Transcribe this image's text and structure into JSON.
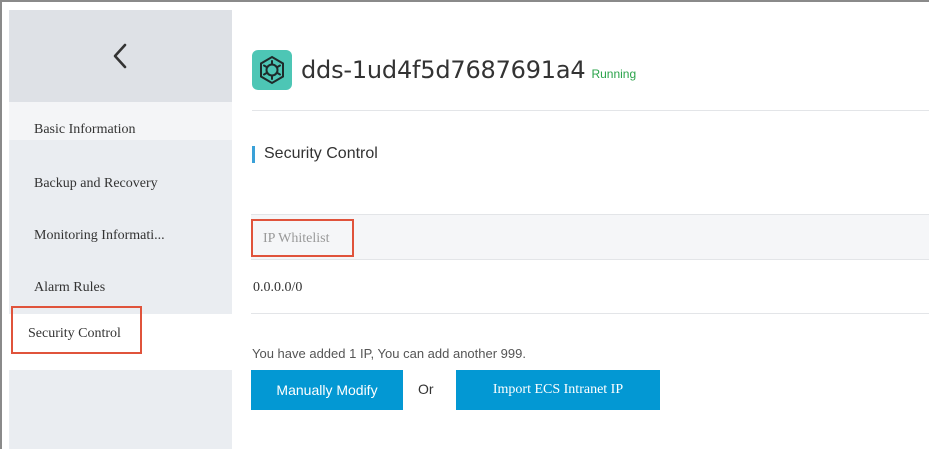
{
  "instance": {
    "name": "dds-1ud4f5d7687691a4",
    "status": "Running",
    "status_color": "#2aa34a",
    "icon": "database-gear-icon",
    "icon_color": "#4dc6b5"
  },
  "sidebar": {
    "back_icon": "chevron-left-icon",
    "items": [
      {
        "label": "Basic Information"
      },
      {
        "label": "Backup and Recovery"
      },
      {
        "label": "Monitoring Informati..."
      },
      {
        "label": "Alarm Rules"
      },
      {
        "label": "Security Control",
        "active": true
      }
    ]
  },
  "section": {
    "title": "Security Control"
  },
  "whitelist": {
    "header": "IP Whitelist",
    "rows": [
      "0.0.0.0/0"
    ]
  },
  "summary": "You have added 1 IP, You can add another 999.",
  "actions": {
    "manual_label": "Manually Modify",
    "or_label": "Or",
    "import_label": "Import ECS Intranet IP"
  },
  "colors": {
    "primary": "#0398d3",
    "highlight": "#e0533b",
    "section_accent": "#3aa1d8"
  }
}
